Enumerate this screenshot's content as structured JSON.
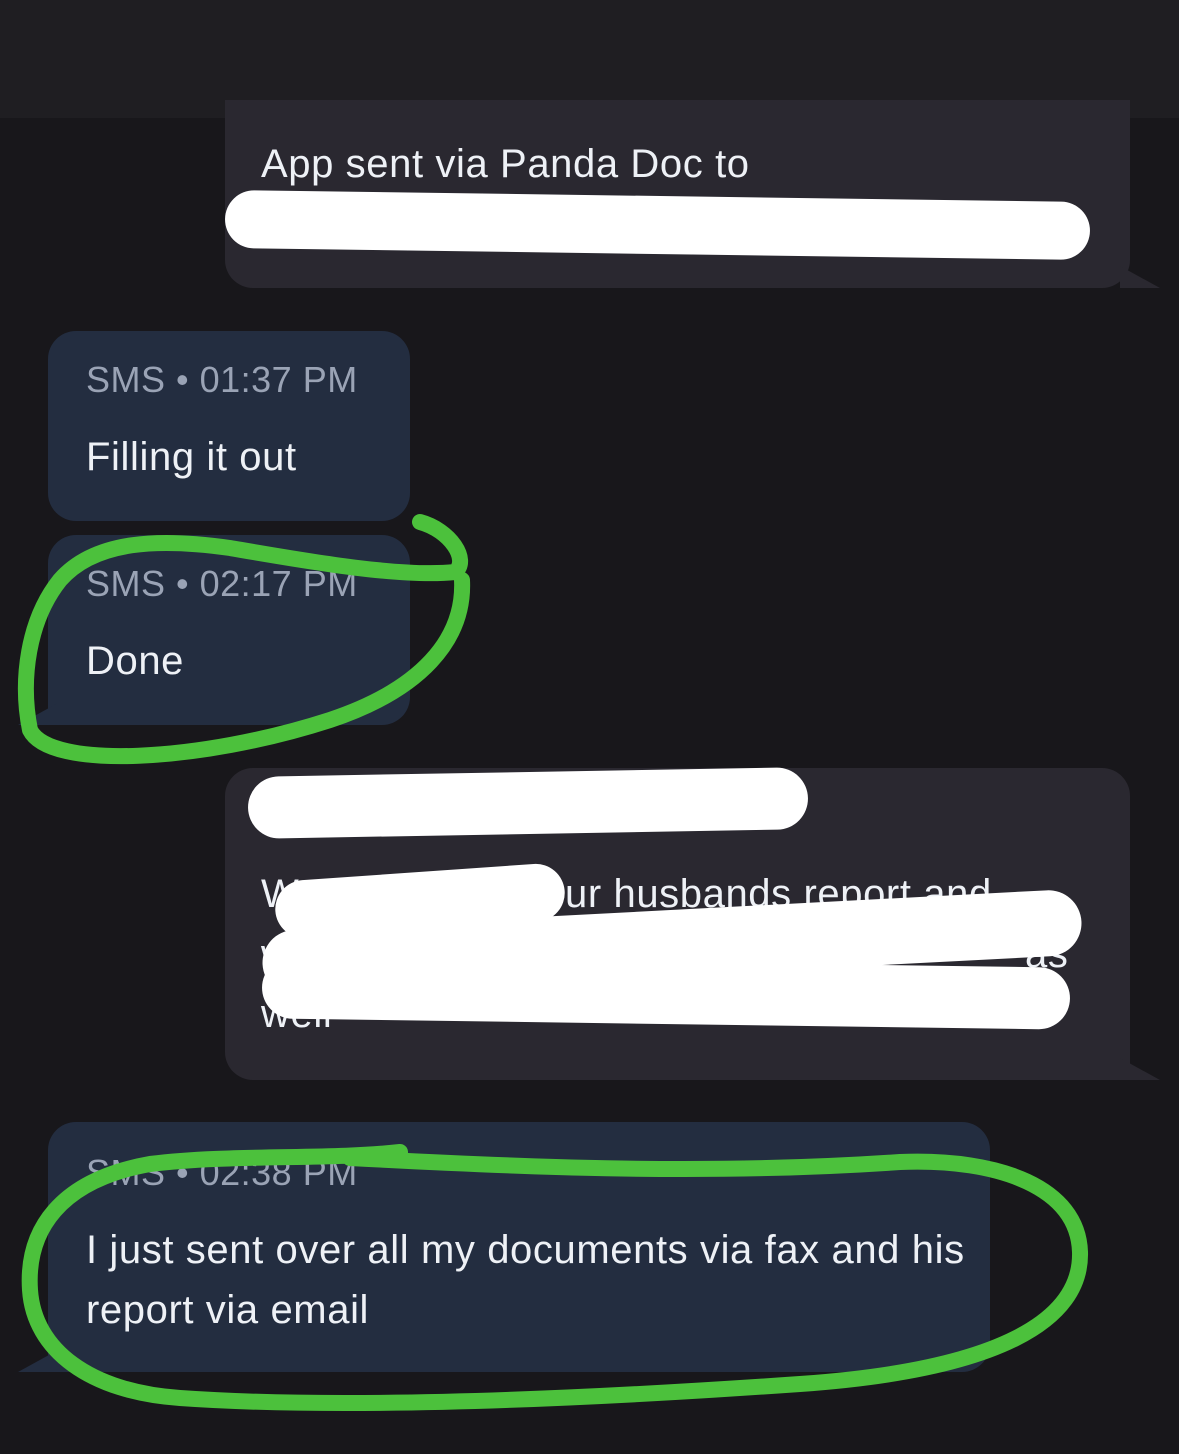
{
  "conversation": {
    "messages": [
      {
        "direction": "outgoing",
        "text": "App sent via Panda Doc to"
      },
      {
        "direction": "incoming",
        "channel": "SMS",
        "time": "01:37 PM",
        "meta": "SMS • 01:37 PM",
        "text": "Filling it out"
      },
      {
        "direction": "incoming",
        "channel": "SMS",
        "time": "02:17 PM",
        "meta": "SMS • 02:17 PM",
        "text": "Done"
      },
      {
        "direction": "outgoing",
        "text_fragments": [
          "W",
          "ur husbands report and",
          "will",
          "as",
          "well"
        ]
      },
      {
        "direction": "incoming",
        "channel": "SMS",
        "time": "02:38 PM",
        "meta": "SMS • 02:38 PM",
        "text": "I just sent over all my documents via fax and his report via email"
      }
    ]
  },
  "annotations": {
    "highlight_color": "#4cc13c",
    "redaction_color": "#ffffff"
  },
  "colors": {
    "background": "#18171b",
    "outgoing_bubble": "#2a2830",
    "incoming_bubble": "#232d40"
  }
}
